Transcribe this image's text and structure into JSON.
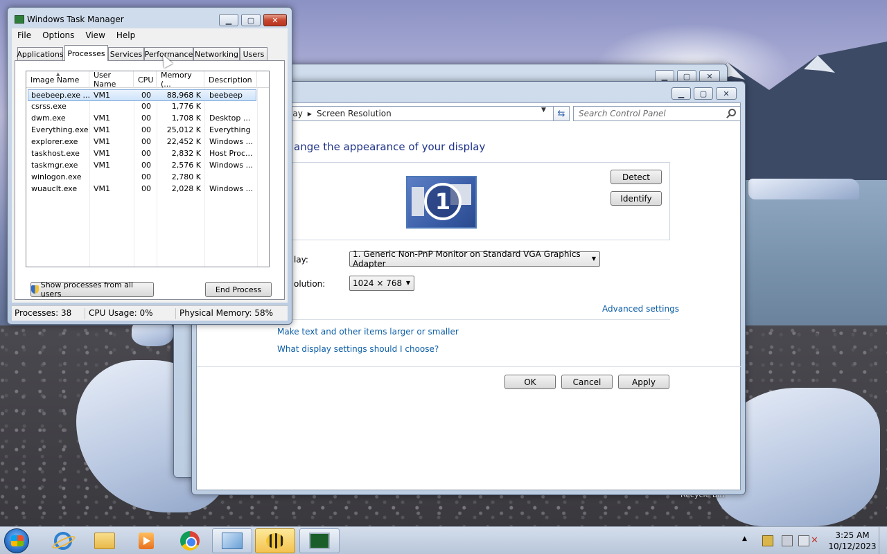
{
  "desktop": {
    "recycle_label": "Recycle Bin"
  },
  "control_panel": {
    "breadcrumb_partial": "lay",
    "breadcrumb_current": "Screen Resolution",
    "search_placeholder": "Search Control Panel",
    "heading_partial": "ange the appearance of your display",
    "detect_button": "Detect",
    "identify_button": "Identify",
    "monitor_number": "1",
    "display_label_partial": "lay:",
    "display_value": "1. Generic Non-PnP Monitor on Standard VGA Graphics Adapter",
    "resolution_label_partial": "olution:",
    "resolution_value": "1024 × 768",
    "advanced_link": "Advanced settings",
    "link_text_size": "Make text and other items larger or smaller",
    "link_display_settings": "What display settings should I choose?",
    "ok_button": "OK",
    "cancel_button": "Cancel",
    "apply_button": "Apply"
  },
  "task_manager": {
    "title": "Windows Task Manager",
    "menu": [
      "File",
      "Options",
      "View",
      "Help"
    ],
    "tabs": [
      "Applications",
      "Processes",
      "Services",
      "Performance",
      "Networking",
      "Users"
    ],
    "active_tab": "Processes",
    "columns": [
      "Image Name",
      "User Name",
      "CPU",
      "Memory (...",
      "Description"
    ],
    "rows": [
      {
        "image": "beebeep.exe ...",
        "user": "VM1",
        "cpu": "00",
        "memory": "88,968 K",
        "desc": "beebeep",
        "selected": true
      },
      {
        "image": "csrss.exe",
        "user": "",
        "cpu": "00",
        "memory": "1,776 K",
        "desc": ""
      },
      {
        "image": "dwm.exe",
        "user": "VM1",
        "cpu": "00",
        "memory": "1,708 K",
        "desc": "Desktop ..."
      },
      {
        "image": "Everything.exe",
        "user": "VM1",
        "cpu": "00",
        "memory": "25,012 K",
        "desc": "Everything"
      },
      {
        "image": "explorer.exe",
        "user": "VM1",
        "cpu": "00",
        "memory": "22,452 K",
        "desc": "Windows ..."
      },
      {
        "image": "taskhost.exe",
        "user": "VM1",
        "cpu": "00",
        "memory": "2,832 K",
        "desc": "Host Proc..."
      },
      {
        "image": "taskmgr.exe",
        "user": "VM1",
        "cpu": "00",
        "memory": "2,576 K",
        "desc": "Windows ..."
      },
      {
        "image": "winlogon.exe",
        "user": "",
        "cpu": "00",
        "memory": "2,780 K",
        "desc": ""
      },
      {
        "image": "wuauclt.exe",
        "user": "VM1",
        "cpu": "00",
        "memory": "2,028 K",
        "desc": "Windows ..."
      }
    ],
    "show_all_button": "Show processes from all users",
    "end_process_button": "End Process",
    "status_processes": "Processes: 38",
    "status_cpu": "CPU Usage: 0%",
    "status_memory": "Physical Memory: 58%"
  },
  "taskbar": {
    "clock_time": "3:25 AM",
    "clock_date": "10/12/2023"
  }
}
